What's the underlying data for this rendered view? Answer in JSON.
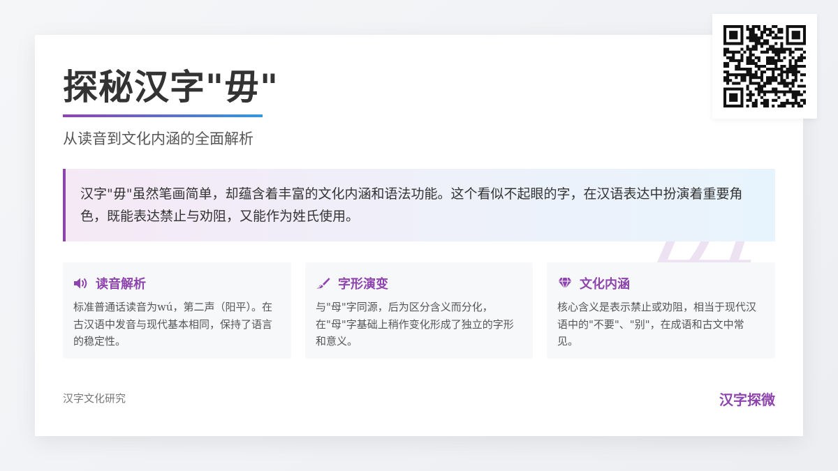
{
  "header": {
    "title": "探秘汉字\"毋\"",
    "subtitle": "从读音到文化内涵的全面解析"
  },
  "intro": {
    "text": "汉字\"毋\"虽然笔画简单，却蕴含着丰富的文化内涵和语法功能。这个看似不起眼的字，在汉语表达中扮演着重要角色，既能表达禁止与劝阻，又能作为姓氏使用。"
  },
  "watermark": {
    "char": "毋"
  },
  "features": [
    {
      "icon": "speaker-icon",
      "title": "读音解析",
      "text": "标准普通话读音为wú，第二声（阳平）。在古汉语中发音与现代基本相同，保持了语言的稳定性。"
    },
    {
      "icon": "brush-icon",
      "title": "字形演变",
      "text": "与\"母\"字同源，后为区分含义而分化，在\"母\"字基础上稍作变化形成了独立的字形和意义。"
    },
    {
      "icon": "gem-icon",
      "title": "文化内涵",
      "text": "核心含义是表示禁止或劝阻，相当于现代汉语中的\"不要\"、\"别\"，在成语和古文中常见。"
    }
  ],
  "footer": {
    "left": "汉字文化研究",
    "right": "汉字探微"
  },
  "colors": {
    "accent": "#8e44ad",
    "accent_secondary": "#3498db",
    "text": "#333333"
  }
}
